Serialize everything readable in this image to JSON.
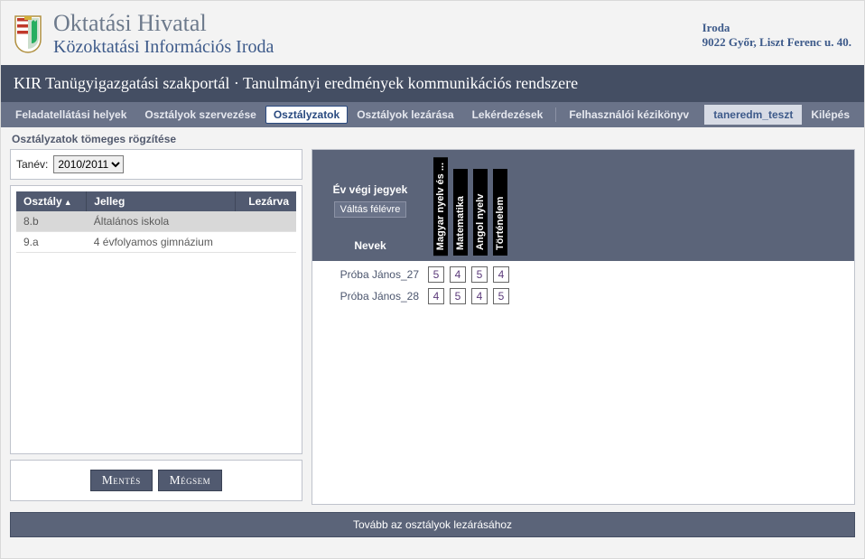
{
  "header": {
    "org_name": "Oktatási Hivatal",
    "org_sub": "Közoktatási Információs Iroda",
    "office_label": "Iroda",
    "office_address": "9022 Győr, Liszt Ferenc u. 40."
  },
  "portal_bar": "KIR Tanügyigazgatási szakportál · Tanulmányi eredmények kommunikációs rendszere",
  "menu": {
    "items": [
      "Feladatellátási helyek",
      "Osztályok szervezése",
      "Osztályzatok",
      "Osztályok lezárása",
      "Lekérdezések",
      "Felhasználói kézikönyv"
    ],
    "active_index": 2,
    "user": "taneredm_teszt",
    "logout": "Kilépés"
  },
  "page_title": "Osztályzatok tömeges rögzítése",
  "tanev": {
    "label": "Tanév:",
    "selected": "2010/2011"
  },
  "class_table": {
    "headers": {
      "osztaly": "Osztály",
      "jelleg": "Jelleg",
      "lezarva": "Lezárva"
    },
    "rows": [
      {
        "osztaly": "8.b",
        "jelleg": "Általános iskola",
        "lezarva": "",
        "selected": true
      },
      {
        "osztaly": "9.a",
        "jelleg": "4 évfolyamos gimnázium",
        "lezarva": "",
        "selected": false
      }
    ]
  },
  "buttons": {
    "save": "Mentés",
    "cancel": "Mégsem"
  },
  "grades": {
    "year_end_label": "Év végi jegyek",
    "switch_label": "Váltás félévre",
    "names_label": "Nevek",
    "subjects": [
      "Magyar nyelv és ...",
      "Matematika",
      "Angol nyelv",
      "Történelem"
    ],
    "students": [
      {
        "name": "Próba János_27",
        "marks": [
          "5",
          "4",
          "5",
          "4"
        ]
      },
      {
        "name": "Próba János_28",
        "marks": [
          "4",
          "5",
          "4",
          "5"
        ]
      }
    ]
  },
  "footer": "Tovább az osztályok lezárásához"
}
